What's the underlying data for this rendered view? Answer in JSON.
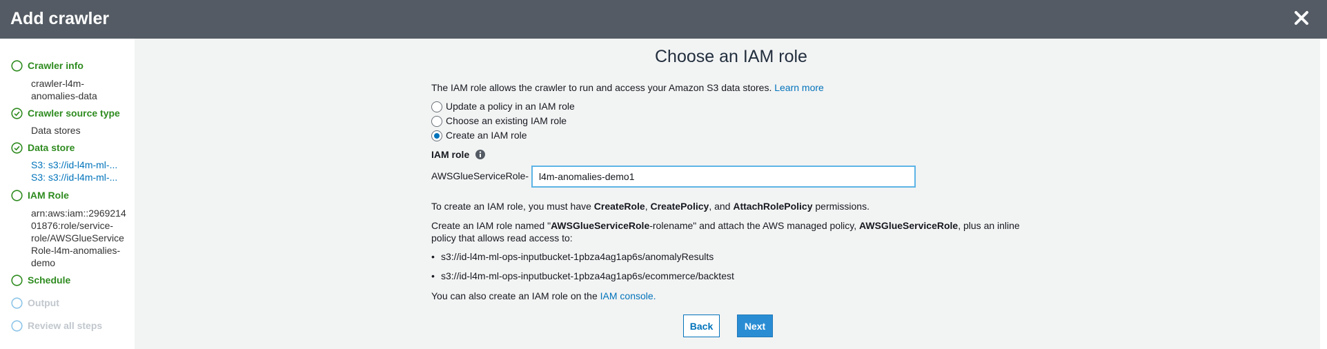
{
  "header": {
    "title": "Add crawler",
    "close_icon": "close-icon"
  },
  "sidebar": {
    "steps": [
      {
        "label": "Crawler info",
        "state": "done-open",
        "details": [
          "crawler-l4m-",
          "anomalies-data"
        ]
      },
      {
        "label": "Crawler source type",
        "state": "done",
        "details": [
          "Data stores"
        ]
      },
      {
        "label": "Data store",
        "state": "done",
        "details": [
          "S3: s3://id-l4m-ml-...",
          "S3: s3://id-l4m-ml-..."
        ]
      },
      {
        "label": "IAM Role",
        "state": "current",
        "details": [
          "arn:aws:iam::2969214",
          "01876:role/service-",
          "role/AWSGlueService",
          "Role-l4m-anomalies-",
          "demo"
        ]
      },
      {
        "label": "Schedule",
        "state": "todo",
        "details": []
      },
      {
        "label": "Output",
        "state": "future",
        "details": []
      },
      {
        "label": "Review all steps",
        "state": "future",
        "details": []
      }
    ]
  },
  "main": {
    "title": "Choose an IAM role",
    "intro": "The IAM role allows the crawler to run and access your Amazon S3 data stores.",
    "learn_more": "Learn more",
    "radios": [
      {
        "label": "Update a policy in an IAM role",
        "checked": false
      },
      {
        "label": "Choose an existing IAM role",
        "checked": false
      },
      {
        "label": "Create an IAM role",
        "checked": true
      }
    ],
    "iam_role_label": "IAM role",
    "prefix": "AWSGlueServiceRole-",
    "role_value": "l4m-anomalies-demo1",
    "permissions": {
      "pre": "To create an IAM role, you must have ",
      "p1": "CreateRole",
      "sep1": ", ",
      "p2": "CreatePolicy",
      "sep2": ", and ",
      "p3": "AttachRolePolicy",
      "post": " permissions."
    },
    "create_note": {
      "t1": "Create an IAM role named \"",
      "b1": "AWSGlueServiceRole",
      "t2": "-rolename\" and attach the AWS managed policy, ",
      "b2": "AWSGlueServiceRole",
      "t3": ", plus an inline",
      "line2": "policy that allows read access to:"
    },
    "paths": [
      "s3://id-l4m-ml-ops-inputbucket-1pbza4ag1ap6s/anomalyResults",
      "s3://id-l4m-ml-ops-inputbucket-1pbza4ag1ap6s/ecommerce/backtest"
    ],
    "console_pre": "You can also create an IAM role on the ",
    "console_link": "IAM console.",
    "back_label": "Back",
    "next_label": "Next"
  }
}
